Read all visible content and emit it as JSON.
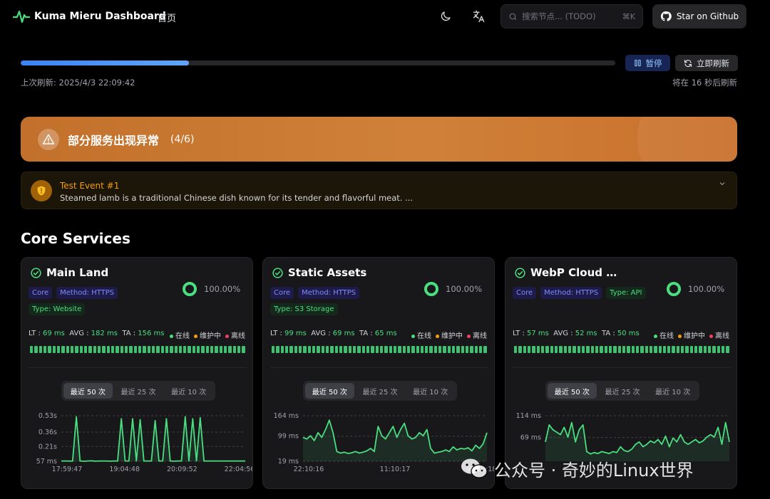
{
  "header": {
    "brand": "Kuma Mieru Dashboard",
    "nav_home": "首页",
    "search_placeholder": "搜索节点... (TODO)",
    "search_shortcut": "⌘K",
    "star_label": "Star on Github",
    "icons": [
      "pulse-logo-icon",
      "moon-icon",
      "translate-icon",
      "search-icon",
      "github-icon"
    ]
  },
  "refresh": {
    "progress_fraction": 0.283,
    "pause_label": "暂停",
    "refresh_now_label": "立即刷新",
    "last_refresh": "上次刷新: 2025/4/3 22:09:42",
    "next_refresh": "将在 16 秒后刷新"
  },
  "banner": {
    "title": "部分服务出现异常",
    "count": "(4/6)",
    "color": "#c97330"
  },
  "event": {
    "title": "Test Event #1",
    "description": "Steamed lamb is a traditional Chinese dish known for its tender and flavorful meat. ..."
  },
  "section_title": "Core Services",
  "legend": {
    "online": "在线",
    "maintenance": "维护中",
    "offline": "离线",
    "online_color": "#4ade80",
    "maintenance_color": "#f59e0b",
    "offline_color": "#f43f5e"
  },
  "ranges": [
    "最近 50 次",
    "最近 25 次",
    "最近 10 次"
  ],
  "cards": [
    {
      "name": "Main Land",
      "tags": [
        {
          "text": "Core",
          "color": "blue"
        },
        {
          "text": "Method: HTTPS",
          "color": "purple"
        },
        {
          "text": "Type: Website",
          "color": "green"
        }
      ],
      "uptime": "100.00%",
      "lt_label": "LT : ",
      "lt": "69 ms",
      "avg_label": "AVG : ",
      "avg": "182 ms",
      "ta_label": "TA : ",
      "ta": "156 ms"
    },
    {
      "name": "Static Assets",
      "tags": [
        {
          "text": "Core",
          "color": "blue"
        },
        {
          "text": "Method: HTTPS",
          "color": "purple"
        },
        {
          "text": "Type: S3 Storage",
          "color": "green"
        }
      ],
      "uptime": "100.00%",
      "lt_label": "LT : ",
      "lt": "99 ms",
      "avg_label": "AVG : ",
      "avg": "69 ms",
      "ta_label": "TA : ",
      "ta": "65 ms"
    },
    {
      "name": "WebP Cloud Se…",
      "tags": [
        {
          "text": "Core",
          "color": "blue"
        },
        {
          "text": "Method: HTTPS",
          "color": "purple"
        },
        {
          "text": "Type: API",
          "color": "green"
        }
      ],
      "uptime": "100.00%",
      "lt_label": "LT : ",
      "lt": "57 ms",
      "avg_label": "AVG : ",
      "avg": "52 ms",
      "ta_label": "TA : ",
      "ta": "50 ms"
    }
  ],
  "chart_data": [
    {
      "type": "line",
      "yticks": [
        "0.53s",
        "0.36s",
        "0.21s",
        "57 ms"
      ],
      "ytick_values": [
        530,
        360,
        210,
        57
      ],
      "xticks": [
        "17:59:47",
        "19:04:48",
        "20:09:52",
        "22:04:56"
      ],
      "ylim": [
        57,
        530
      ],
      "values": [
        60,
        60,
        60,
        58,
        520,
        60,
        58,
        60,
        62,
        58,
        60,
        60,
        60,
        58,
        60,
        60,
        500,
        60,
        60,
        500,
        60,
        490,
        60,
        60,
        60,
        480,
        60,
        60,
        500,
        60,
        58,
        60,
        60,
        520,
        60,
        500,
        60,
        510,
        60,
        60,
        60,
        60,
        60,
        60,
        60,
        60,
        60,
        60,
        60,
        60
      ]
    },
    {
      "type": "line",
      "yticks": [
        "164 ms",
        "99 ms",
        "19 ms"
      ],
      "ytick_values": [
        164,
        99,
        19
      ],
      "xticks": [
        "22:10:16",
        "11:10:17",
        "00:10:18"
      ],
      "ylim": [
        19,
        164
      ],
      "values": [
        95,
        90,
        100,
        85,
        110,
        95,
        120,
        150,
        110,
        50,
        45,
        48,
        44,
        46,
        50,
        45,
        48,
        52,
        60,
        50,
        130,
        100,
        90,
        110,
        130,
        95,
        120,
        140,
        100,
        90,
        95,
        110,
        100,
        120,
        60,
        45,
        48,
        50,
        55,
        50,
        65,
        55,
        60,
        58,
        62,
        52,
        70,
        60,
        75,
        110
      ]
    },
    {
      "type": "line",
      "yticks": [
        "114 ms",
        "69 ms"
      ],
      "ytick_values": [
        114,
        69
      ],
      "xticks": [],
      "ylim": [
        20,
        114
      ],
      "values": [
        60,
        95,
        85,
        80,
        75,
        90,
        70,
        100,
        60,
        85,
        95,
        40,
        35,
        38,
        36,
        40,
        38,
        36,
        40,
        38,
        50,
        42,
        40,
        45,
        55,
        60,
        50,
        55,
        62,
        58,
        65,
        55,
        72,
        50,
        68,
        60,
        75,
        60,
        55,
        60,
        65,
        58,
        62,
        70,
        75,
        70,
        90,
        55,
        100,
        60
      ]
    }
  ],
  "watermark": "公众号 · 奇妙的Linux世界"
}
